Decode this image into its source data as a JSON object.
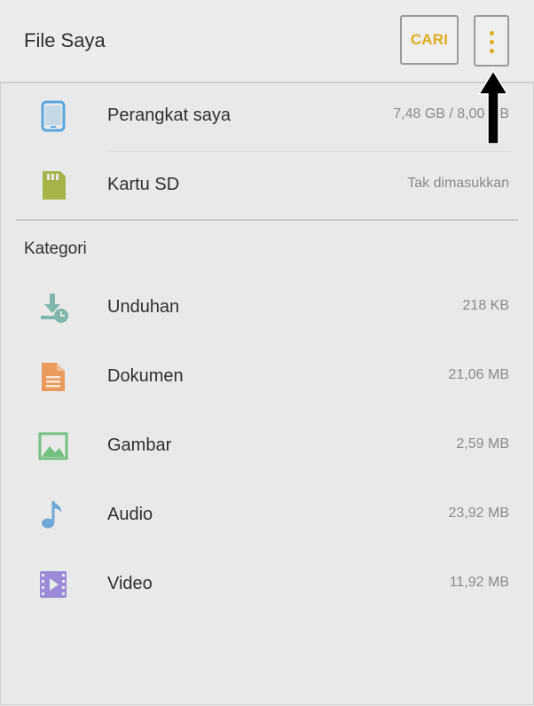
{
  "header": {
    "title": "File Saya",
    "search_label": "CARI",
    "more_icon": "more-vertical-icon"
  },
  "storage": [
    {
      "label": "Perangkat saya",
      "value": "7,48 GB / 8,00 GB",
      "icon": "phone-icon"
    },
    {
      "label": "Kartu SD",
      "value": "Tak dimasukkan",
      "icon": "sd-card-icon"
    }
  ],
  "category_title": "Kategori",
  "categories": [
    {
      "label": "Unduhan",
      "value": "218 KB",
      "icon": "download-icon"
    },
    {
      "label": "Dokumen",
      "value": "21,06 MB",
      "icon": "document-icon"
    },
    {
      "label": "Gambar",
      "value": "2,59 MB",
      "icon": "image-icon"
    },
    {
      "label": "Audio",
      "value": "23,92 MB",
      "icon": "music-note-icon"
    },
    {
      "label": "Video",
      "value": "11,92 MB",
      "icon": "video-icon"
    }
  ],
  "colors": {
    "accent": "#e0ab1d",
    "phone": "#5aa6dd",
    "sd_card": "#a7b44a",
    "download": "#7fb7ad",
    "document": "#e99a5c",
    "image": "#72c07f",
    "audio": "#6fa8d6",
    "video": "#9b8ad8",
    "annotation_arrow": "#000000"
  }
}
